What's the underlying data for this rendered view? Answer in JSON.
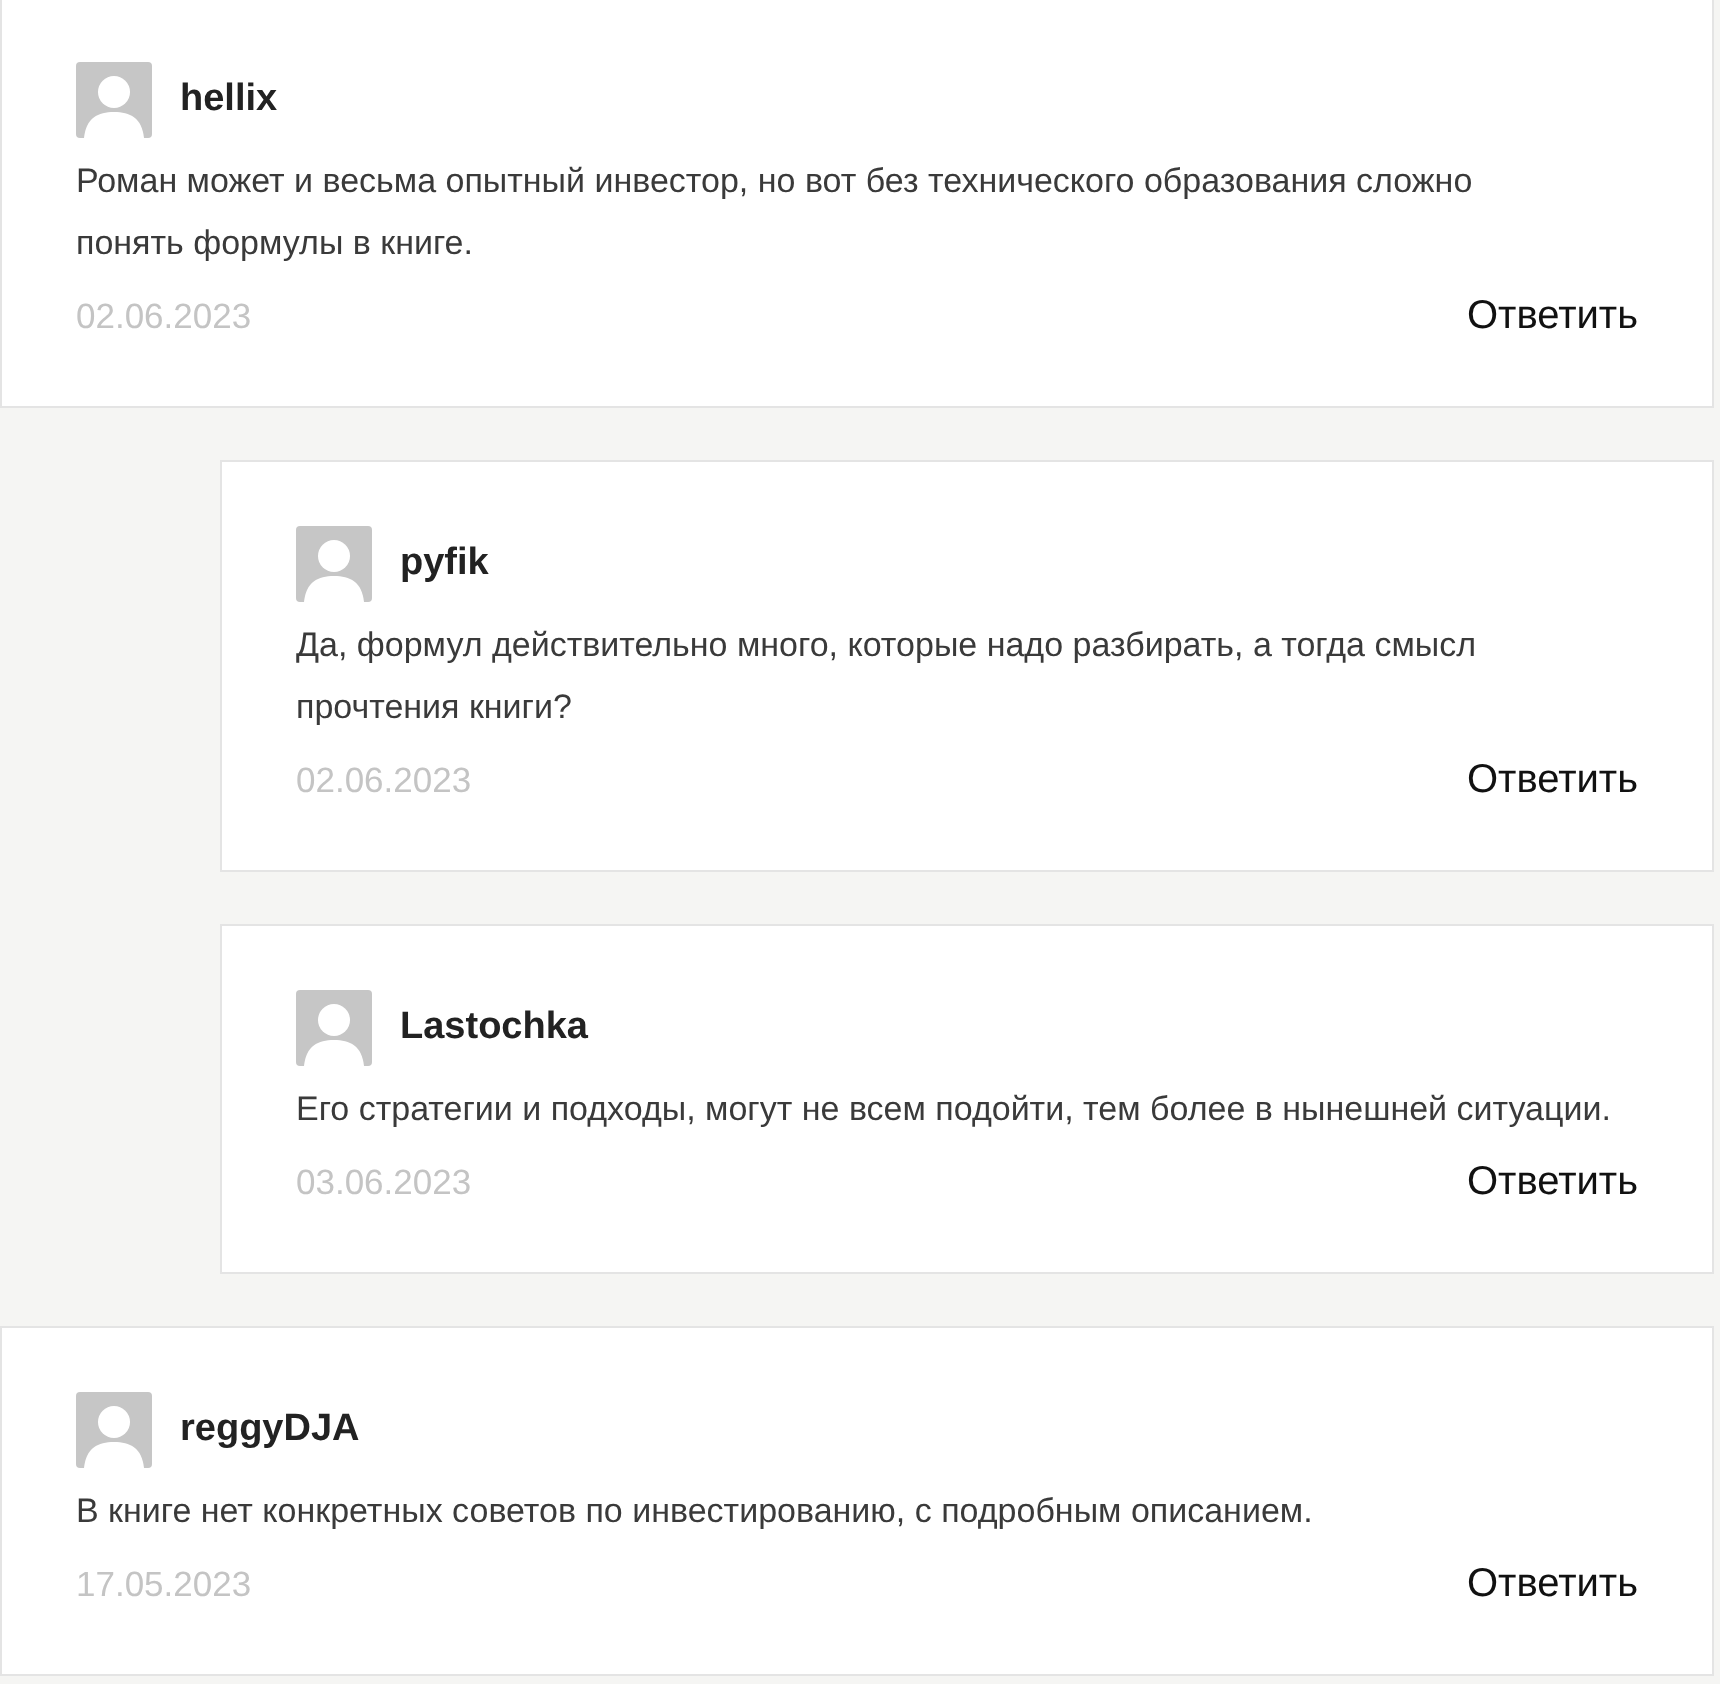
{
  "comments": [
    {
      "author": "hellix",
      "text": "Роман может и весьма опытный инвестор, но вот без технического образования сложно понять формулы в книге.",
      "date": "02.06.2023",
      "reply_label": "Ответить",
      "children": [
        {
          "author": "pyfik",
          "text": "Да, формул действительно много, которые надо разбирать, а тогда смысл прочтения книги?",
          "date": "02.06.2023",
          "reply_label": "Ответить"
        },
        {
          "author": "Lastochka",
          "text": "Его стратегии и подходы, могут не всем подойти, тем более в нынешней ситуации.",
          "date": "03.06.2023",
          "reply_label": "Ответить"
        }
      ]
    },
    {
      "author": "reggyDJA",
      "text": "В книге нет конкретных советов по инвестированию, с подробным описанием.",
      "date": "17.05.2023",
      "reply_label": "Ответить"
    }
  ]
}
